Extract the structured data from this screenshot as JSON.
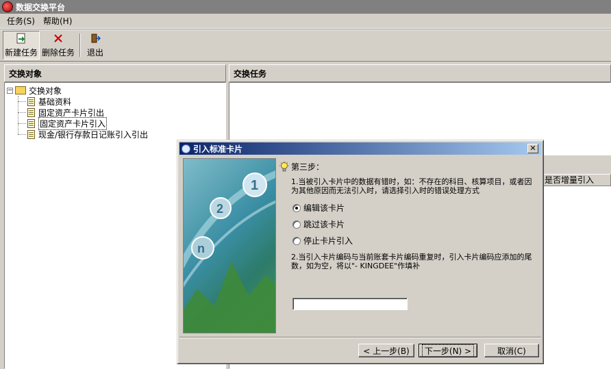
{
  "window": {
    "title": "数据交换平台"
  },
  "menu": [
    {
      "label": "任务(S)"
    },
    {
      "label": "帮助(H)"
    }
  ],
  "toolbar": {
    "new_task": "新建任务",
    "delete_task": "删除任务",
    "exit": "退出"
  },
  "left_pane": {
    "header": "交换对象",
    "tree": {
      "root": "交换对象",
      "children": [
        {
          "label": "基础资料"
        },
        {
          "label": "固定资产卡片引出"
        },
        {
          "label": "固定资产卡片引入"
        },
        {
          "label": "现金/银行存款日记账引入引出"
        }
      ]
    }
  },
  "right_pane": {
    "header": "交换任务",
    "column_header": "是否增量引入"
  },
  "dialog": {
    "title": "引入标准卡片",
    "close_glyph": "✕",
    "step_label": "第三步：",
    "instruction_1": "1.当被引入卡片中的数据有错时，如：不存在的科目、核算项目，或者因为其他原因而无法引入时，请选择引入时的错误处理方式",
    "options": [
      {
        "label": "编辑该卡片",
        "checked": true
      },
      {
        "label": "跳过该卡片",
        "checked": false
      },
      {
        "label": "停止卡片引入",
        "checked": false
      }
    ],
    "instruction_2": "2.当引入卡片编码与当前账套卡片编码重复时，引入卡片编码应添加的尾数，如为空，将以\"- KINGDEE\"作填补",
    "suffix_value": "",
    "buttons": {
      "back": "< 上一步(B)",
      "next": "下一步(N) >",
      "cancel": "取消(C)"
    }
  },
  "colors": {
    "dialog_title_start": "#0a246a",
    "dialog_title_end": "#a6caf0",
    "window_title_inactive": "#808080"
  }
}
